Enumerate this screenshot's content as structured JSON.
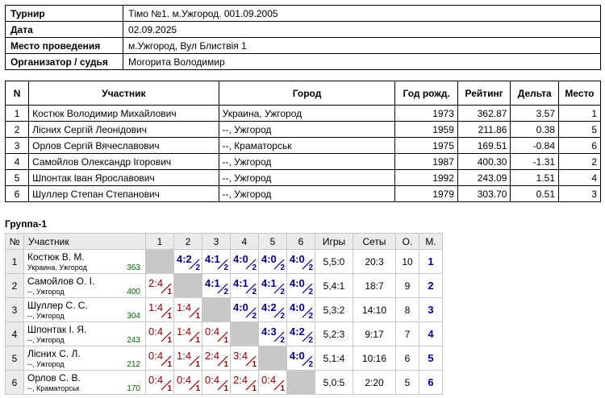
{
  "info": [
    {
      "key": "Турнир",
      "value": "Тімо №1. м.Ужгород. 001.09.2005"
    },
    {
      "key": "Дата",
      "value": "02.09.2025"
    },
    {
      "key": "Место проведения",
      "value": "м.Ужгород, Вул Блиствія 1"
    },
    {
      "key": "Организатор / судья",
      "value": "Могорита Володимир"
    }
  ],
  "participants": {
    "headers": [
      "N",
      "Участник",
      "Город",
      "Год рожд.",
      "Рейтинг",
      "Дельта",
      "Место"
    ],
    "rows": [
      [
        "1",
        "Костюк Володимир Михайлович",
        "Украина, Ужгород",
        "1973",
        "362.87",
        "3.57",
        "1"
      ],
      [
        "2",
        "Лісних Сергій Леонідович",
        "--, Ужгород",
        "1959",
        "211.86",
        "0.38",
        "5"
      ],
      [
        "3",
        "Орлов Сергій Вячеславович",
        "--, Краматорськ",
        "1975",
        "169.51",
        "-0.84",
        "6"
      ],
      [
        "4",
        "Самойлов Олександр Ігорович",
        "--, Ужгород",
        "1987",
        "400.30",
        "-1.31",
        "2"
      ],
      [
        "5",
        "Шпонтак Іван Ярославович",
        "--, Ужгород",
        "1992",
        "243.09",
        "1.51",
        "4"
      ],
      [
        "6",
        "Шуллер Степан Степанович",
        "--, Ужгород",
        "1979",
        "303.70",
        "0.51",
        "3"
      ]
    ]
  },
  "group": {
    "title": "Группа-1",
    "headers": {
      "num": "№",
      "player": "Участник",
      "cols": [
        "1",
        "2",
        "3",
        "4",
        "5",
        "6"
      ],
      "games": "Игры",
      "sets": "Сеты",
      "points": "О.",
      "place": "М."
    },
    "rows": [
      {
        "n": "1",
        "name": "Костюк В. М.",
        "city": "Украина, Ужгород",
        "rating": "363",
        "results": [
          null,
          {
            "s": "4:2",
            "r": "2",
            "w": true
          },
          {
            "s": "4:1",
            "r": "2",
            "w": true
          },
          {
            "s": "4:0",
            "r": "2",
            "w": true
          },
          {
            "s": "4:0",
            "r": "2",
            "w": true
          },
          {
            "s": "4:0",
            "r": "2",
            "w": true
          }
        ],
        "games": "5,5:0",
        "sets": "20:3",
        "points": "10",
        "place": "1"
      },
      {
        "n": "2",
        "name": "Самойлов О. І.",
        "city": "--, Ужгород",
        "rating": "400",
        "results": [
          {
            "s": "2:4",
            "r": "1",
            "w": false
          },
          null,
          {
            "s": "4:1",
            "r": "2",
            "w": true
          },
          {
            "s": "4:1",
            "r": "2",
            "w": true
          },
          {
            "s": "4:1",
            "r": "2",
            "w": true
          },
          {
            "s": "4:0",
            "r": "2",
            "w": true
          }
        ],
        "games": "5,4:1",
        "sets": "18:7",
        "points": "9",
        "place": "2"
      },
      {
        "n": "3",
        "name": "Шуллер С. С.",
        "city": "--, Ужгород",
        "rating": "304",
        "results": [
          {
            "s": "1:4",
            "r": "1",
            "w": false
          },
          {
            "s": "1:4",
            "r": "1",
            "w": false
          },
          null,
          {
            "s": "4:0",
            "r": "2",
            "w": true
          },
          {
            "s": "4:2",
            "r": "2",
            "w": true
          },
          {
            "s": "4:0",
            "r": "2",
            "w": true
          }
        ],
        "games": "5,3:2",
        "sets": "14:10",
        "points": "8",
        "place": "3"
      },
      {
        "n": "4",
        "name": "Шпонтак І. Я.",
        "city": "--, Ужгород",
        "rating": "243",
        "results": [
          {
            "s": "0:4",
            "r": "1",
            "w": false
          },
          {
            "s": "1:4",
            "r": "1",
            "w": false
          },
          {
            "s": "0:4",
            "r": "1",
            "w": false
          },
          null,
          {
            "s": "4:3",
            "r": "2",
            "w": true
          },
          {
            "s": "4:2",
            "r": "2",
            "w": true
          }
        ],
        "games": "5,2:3",
        "sets": "9:17",
        "points": "7",
        "place": "4"
      },
      {
        "n": "5",
        "name": "Лісних С. Л.",
        "city": "--, Ужгород",
        "rating": "212",
        "results": [
          {
            "s": "0:4",
            "r": "1",
            "w": false
          },
          {
            "s": "1:4",
            "r": "1",
            "w": false
          },
          {
            "s": "2:4",
            "r": "1",
            "w": false
          },
          {
            "s": "3:4",
            "r": "1",
            "w": false
          },
          null,
          {
            "s": "4:0",
            "r": "2",
            "w": true
          }
        ],
        "games": "5,1:4",
        "sets": "10:16",
        "points": "6",
        "place": "5"
      },
      {
        "n": "6",
        "name": "Орлов С. В.",
        "city": "--, Краматорськ",
        "rating": "170",
        "results": [
          {
            "s": "0:4",
            "r": "1",
            "w": false
          },
          {
            "s": "0:4",
            "r": "1",
            "w": false
          },
          {
            "s": "0:4",
            "r": "1",
            "w": false
          },
          {
            "s": "2:4",
            "r": "1",
            "w": false
          },
          {
            "s": "0:4",
            "r": "1",
            "w": false
          },
          null
        ],
        "games": "5,0:5",
        "sets": "2:20",
        "points": "5",
        "place": "6"
      }
    ]
  }
}
